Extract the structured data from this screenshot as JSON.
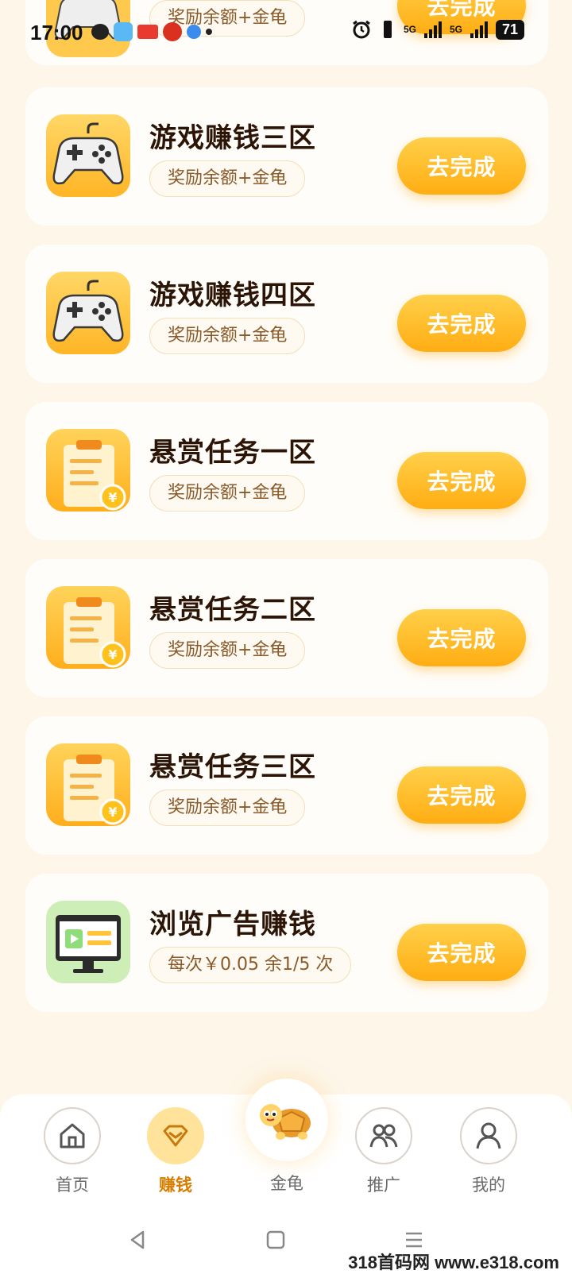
{
  "status_bar": {
    "time": "17:00",
    "network_1": "5G",
    "network_2": "5G",
    "battery": "71"
  },
  "partial_card": {
    "pill_text": "奖励余额+金龟",
    "button_label": "去完成"
  },
  "tasks": [
    {
      "title": "游戏赚钱三区",
      "reward": "奖励余额+金龟",
      "button_label": "去完成",
      "icon": "gamepad-icon"
    },
    {
      "title": "游戏赚钱四区",
      "reward": "奖励余额+金龟",
      "button_label": "去完成",
      "icon": "gamepad-icon"
    },
    {
      "title": "悬赏任务一区",
      "reward": "奖励余额+金龟",
      "button_label": "去完成",
      "icon": "clipboard-coin-icon"
    },
    {
      "title": "悬赏任务二区",
      "reward": "奖励余额+金龟",
      "button_label": "去完成",
      "icon": "clipboard-coin-icon"
    },
    {
      "title": "悬赏任务三区",
      "reward": "奖励余额+金龟",
      "button_label": "去完成",
      "icon": "clipboard-coin-icon"
    },
    {
      "title": "浏览广告赚钱",
      "reward": "每次￥0.05 余1/5 次",
      "button_label": "去完成",
      "icon": "monitor-icon"
    }
  ],
  "bottom_nav": {
    "home": "首页",
    "earn": "赚钱",
    "turtle": "金龟",
    "promote": "推广",
    "mine": "我的",
    "active": "earn"
  },
  "watermark": "318首码网 www.e318.com",
  "colors": {
    "background": "#fdf6e9",
    "button": "#ffad12",
    "active_nav": "#d77d00"
  }
}
